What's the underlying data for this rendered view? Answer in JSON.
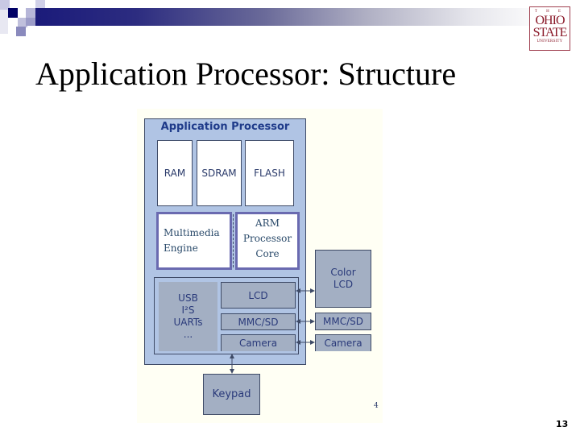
{
  "slide": {
    "title": "Application Processor: Structure",
    "page_number": "13",
    "logo": {
      "line1": "T H E",
      "line2": "OHIO",
      "line3": "STATE",
      "line4": "UNIVERSITY"
    }
  },
  "diagram": {
    "container_label": "Application Processor",
    "memory": [
      "RAM",
      "SDRAM",
      "FLASH"
    ],
    "cores": {
      "multimedia": [
        "Multimedia",
        "Engine"
      ],
      "arm": [
        "ARM",
        "Processor",
        "Core"
      ]
    },
    "peripherals": {
      "interfaces": [
        "USB",
        "I²S",
        "UARTs",
        "..."
      ],
      "lcd": "LCD",
      "mmc": "MMC/SD",
      "camera": "Camera"
    },
    "external": {
      "color_lcd": [
        "Color",
        "LCD"
      ],
      "mmc": "MMC/SD",
      "camera": "Camera",
      "keypad": "Keypad"
    },
    "figure_number": "4"
  },
  "colors": {
    "ap_fill": "#b0c4e4",
    "box_fill": "#a3afc3",
    "core_border": "#6a6ab0",
    "text_blue": "#2a3a7a",
    "heading_blue": "#1f3b8a",
    "osu_red": "#8b1a2a"
  }
}
